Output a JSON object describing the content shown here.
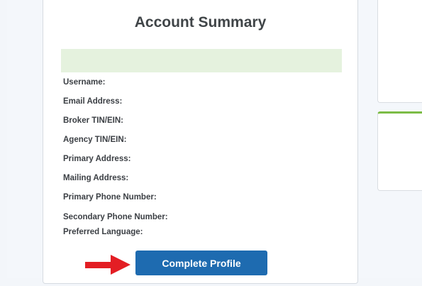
{
  "account_summary": {
    "title": "Account Summary",
    "fields": [
      {
        "label": "Username:"
      },
      {
        "label": "Email Address:"
      },
      {
        "label": "Broker TIN/EIN:"
      },
      {
        "label": "Agency TIN/EIN:"
      },
      {
        "label": "Primary Address:"
      },
      {
        "label": "Mailing Address:"
      },
      {
        "label": "Primary Phone Number:"
      },
      {
        "label": "Secondary Phone Number:"
      },
      {
        "label": "Preferred Language:"
      }
    ],
    "complete_button_label": "Complete Profile"
  },
  "colors": {
    "banner": "#e5f2de",
    "button": "#1e6bb0",
    "arrow": "#e31e24",
    "side_accent": "#7cbc46"
  },
  "icons": {
    "pointer": "right-arrow-icon"
  }
}
